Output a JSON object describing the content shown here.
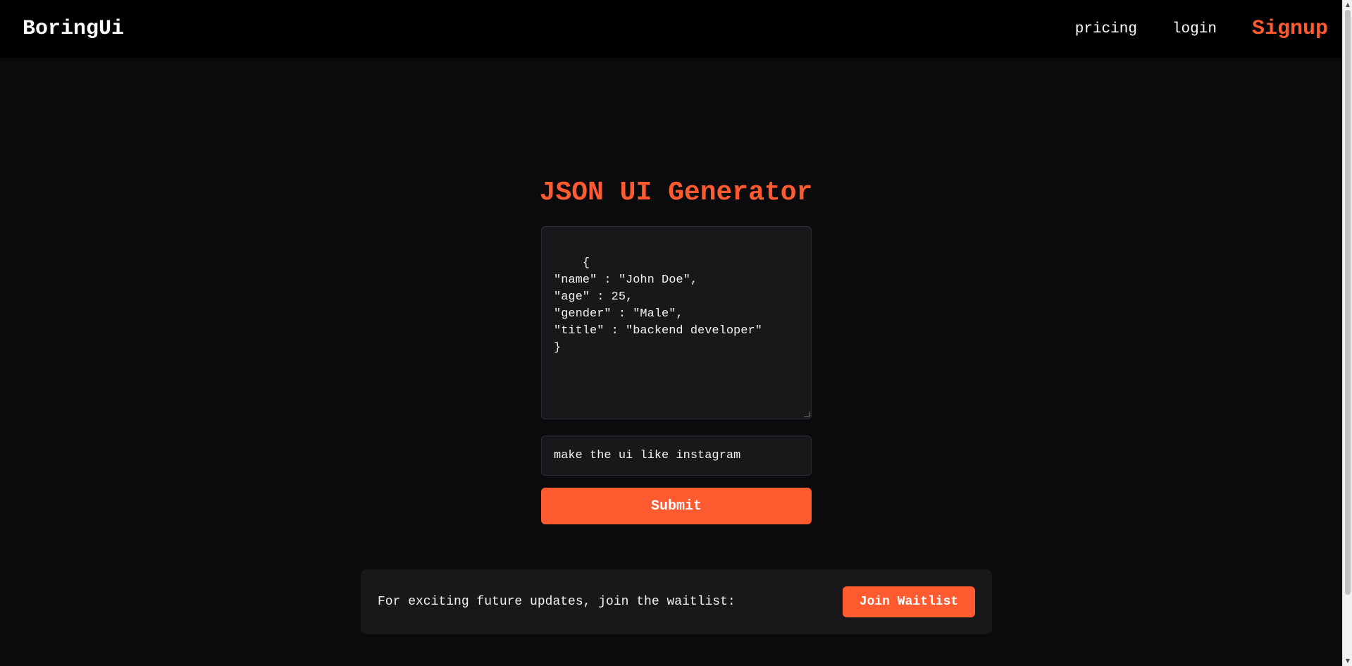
{
  "header": {
    "brand": "BoringUi",
    "nav": {
      "pricing": "pricing",
      "login": "login",
      "signup": "Signup"
    }
  },
  "main": {
    "title": "JSON UI Generator",
    "json_input": "{\n\"name\" : \"John Doe\",\n\"age\" : 25,\n\"gender\" : \"Male\",\n\"title\" : \"backend developer\"\n}",
    "prompt_input": "make the ui like instagram",
    "submit_label": "Submit"
  },
  "waitlist": {
    "text": "For exciting future updates, join the waitlist:",
    "button_label": "Join Waitlist"
  },
  "scrollbar": {
    "up_arrow": "▲",
    "down_arrow": "▼"
  },
  "colors": {
    "accent": "#ff5a30",
    "background": "#0b0b0d",
    "header": "#000000",
    "panel": "#18181b"
  }
}
